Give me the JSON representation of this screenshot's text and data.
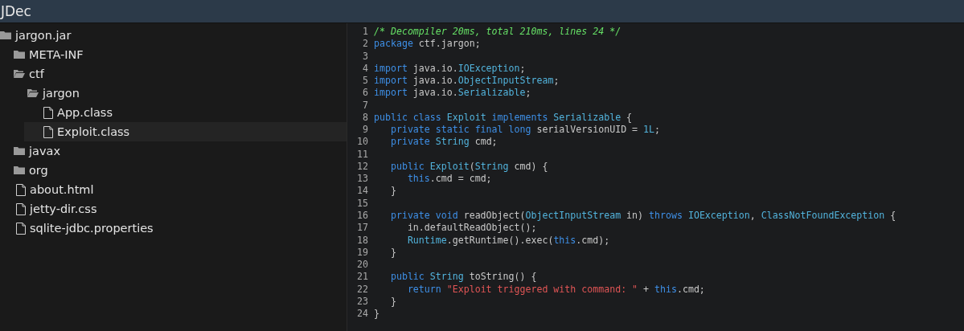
{
  "window": {
    "title": "JDec"
  },
  "tree": [
    {
      "label": "jargon.jar",
      "kind": "archive",
      "selected": false,
      "children": [
        {
          "label": "META-INF",
          "kind": "folder",
          "expanded": false,
          "selected": false
        },
        {
          "label": "ctf",
          "kind": "folder",
          "expanded": true,
          "selected": false,
          "children": [
            {
              "label": "jargon",
              "kind": "folder",
              "expanded": true,
              "selected": false,
              "children": [
                {
                  "label": "App.class",
                  "kind": "file",
                  "selected": false
                },
                {
                  "label": "Exploit.class",
                  "kind": "file",
                  "selected": true
                }
              ]
            }
          ]
        },
        {
          "label": "javax",
          "kind": "folder",
          "expanded": false,
          "selected": false
        },
        {
          "label": "org",
          "kind": "folder",
          "expanded": false,
          "selected": false
        },
        {
          "label": "about.html",
          "kind": "file",
          "selected": false
        },
        {
          "label": "jetty-dir.css",
          "kind": "file",
          "selected": false
        },
        {
          "label": "sqlite-jdbc.properties",
          "kind": "file",
          "selected": false
        }
      ]
    }
  ],
  "code": [
    {
      "number": "1",
      "tokens": [
        {
          "kind": "comment",
          "text": "/* Decompiler 20ms, total 210ms, lines 24 */"
        }
      ]
    },
    {
      "number": "2",
      "tokens": [
        {
          "kind": "keyword",
          "text": "package"
        },
        {
          "kind": "plain",
          "text": " ctf.jargon;"
        }
      ]
    },
    {
      "number": "3"
    },
    {
      "number": "4",
      "tokens": [
        {
          "kind": "keyword",
          "text": "import"
        },
        {
          "kind": "plain",
          "text": " java.io."
        },
        {
          "kind": "type",
          "text": "IOException"
        },
        {
          "kind": "plain",
          "text": ";"
        }
      ]
    },
    {
      "number": "5",
      "tokens": [
        {
          "kind": "keyword",
          "text": "import"
        },
        {
          "kind": "plain",
          "text": " java.io."
        },
        {
          "kind": "type",
          "text": "ObjectInputStream"
        },
        {
          "kind": "plain",
          "text": ";"
        }
      ]
    },
    {
      "number": "6",
      "tokens": [
        {
          "kind": "keyword",
          "text": "import"
        },
        {
          "kind": "plain",
          "text": " java.io."
        },
        {
          "kind": "type",
          "text": "Serializable"
        },
        {
          "kind": "plain",
          "text": ";"
        }
      ]
    },
    {
      "number": "7"
    },
    {
      "number": "8",
      "tokens": [
        {
          "kind": "keyword",
          "text": "public class"
        },
        {
          "kind": "type",
          "text": " Exploit"
        },
        {
          "kind": "keyword",
          "text": " implements"
        },
        {
          "kind": "type",
          "text": " Serializable"
        },
        {
          "kind": "plain",
          "text": " {"
        }
      ]
    },
    {
      "number": "9",
      "tokens": [
        {
          "kind": "keyword",
          "text": "   private static final long"
        },
        {
          "kind": "plain",
          "text": " serialVersionUID = "
        },
        {
          "kind": "type",
          "text": "1L"
        },
        {
          "kind": "plain",
          "text": ";"
        }
      ]
    },
    {
      "number": "10",
      "tokens": [
        {
          "kind": "keyword",
          "text": "   private"
        },
        {
          "kind": "type",
          "text": " String"
        },
        {
          "kind": "plain",
          "text": " cmd;"
        }
      ]
    },
    {
      "number": "11"
    },
    {
      "number": "12",
      "tokens": [
        {
          "kind": "keyword",
          "text": "   public"
        },
        {
          "kind": "type",
          "text": " Exploit"
        },
        {
          "kind": "plain",
          "text": "("
        },
        {
          "kind": "type",
          "text": "String"
        },
        {
          "kind": "plain",
          "text": " cmd) {"
        }
      ]
    },
    {
      "number": "13",
      "tokens": [
        {
          "kind": "keyword",
          "text": "      this"
        },
        {
          "kind": "plain",
          "text": ".cmd = cmd;"
        }
      ]
    },
    {
      "number": "14",
      "tokens": [
        {
          "kind": "plain",
          "text": "   }"
        }
      ]
    },
    {
      "number": "15"
    },
    {
      "number": "16",
      "tokens": [
        {
          "kind": "keyword",
          "text": "   private void"
        },
        {
          "kind": "plain",
          "text": " readObject("
        },
        {
          "kind": "type",
          "text": "ObjectInputStream"
        },
        {
          "kind": "plain",
          "text": " in) "
        },
        {
          "kind": "keyword",
          "text": "throws"
        },
        {
          "kind": "type",
          "text": " IOException"
        },
        {
          "kind": "plain",
          "text": ", "
        },
        {
          "kind": "type",
          "text": "ClassNotFoundException"
        },
        {
          "kind": "plain",
          "text": " {"
        }
      ]
    },
    {
      "number": "17",
      "tokens": [
        {
          "kind": "plain",
          "text": "      in.defaultReadObject();"
        }
      ]
    },
    {
      "number": "18",
      "tokens": [
        {
          "kind": "type",
          "text": "      Runtime"
        },
        {
          "kind": "plain",
          "text": ".getRuntime().exec("
        },
        {
          "kind": "keyword",
          "text": "this"
        },
        {
          "kind": "plain",
          "text": ".cmd);"
        }
      ]
    },
    {
      "number": "19",
      "tokens": [
        {
          "kind": "plain",
          "text": "   }"
        }
      ]
    },
    {
      "number": "20"
    },
    {
      "number": "21",
      "tokens": [
        {
          "kind": "keyword",
          "text": "   public"
        },
        {
          "kind": "type",
          "text": " String"
        },
        {
          "kind": "plain",
          "text": " toString() {"
        }
      ]
    },
    {
      "number": "22",
      "tokens": [
        {
          "kind": "keyword",
          "text": "      return"
        },
        {
          "kind": "string",
          "text": " \"Exploit triggered with command: \""
        },
        {
          "kind": "plain",
          "text": " + "
        },
        {
          "kind": "keyword",
          "text": "this"
        },
        {
          "kind": "plain",
          "text": ".cmd;"
        }
      ]
    },
    {
      "number": "23",
      "tokens": [
        {
          "kind": "plain",
          "text": "   }"
        }
      ]
    },
    {
      "number": "24",
      "tokens": [
        {
          "kind": "plain",
          "text": "}"
        }
      ]
    }
  ]
}
